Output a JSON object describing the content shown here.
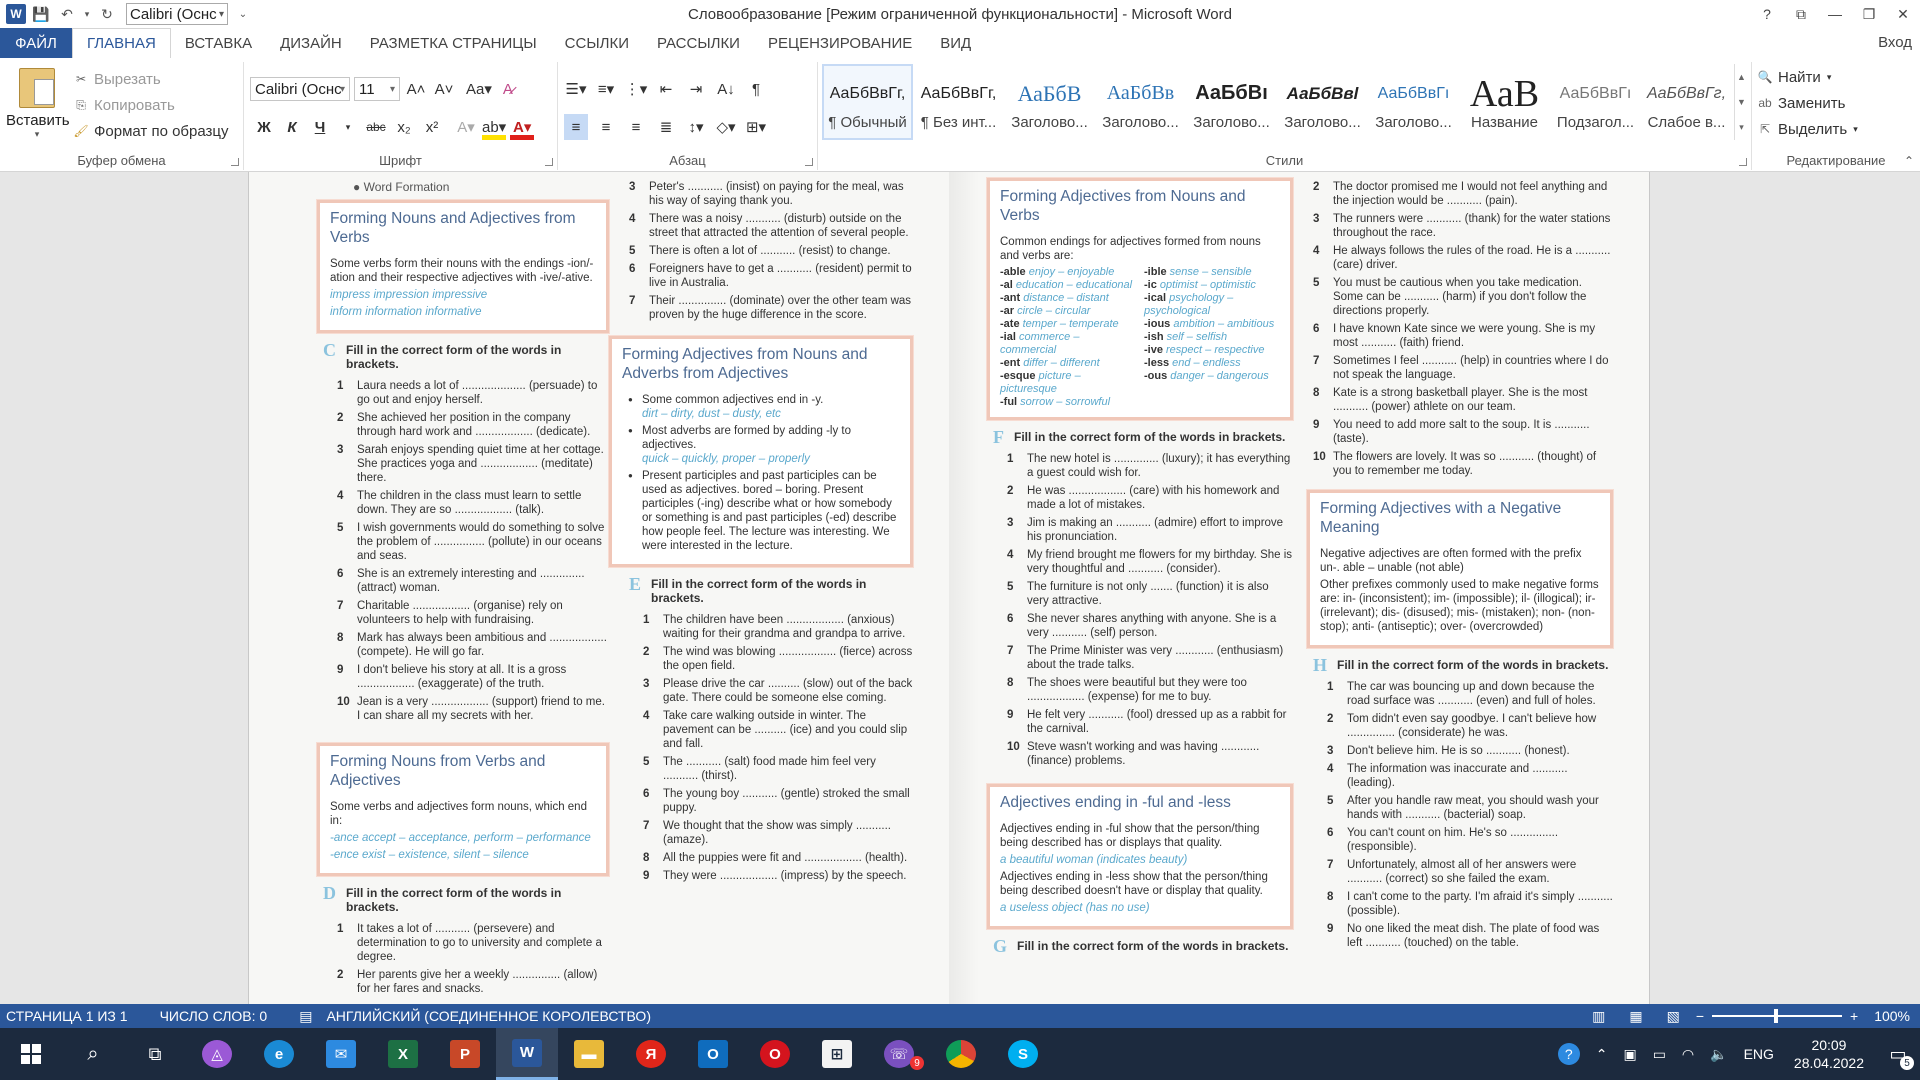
{
  "window": {
    "title": "Словообразование [Режим ограниченной функциональности] - Microsoft Word",
    "qat_font": "Calibri (Оснс",
    "help": "?",
    "sign_in": "Вход"
  },
  "tabs": [
    "ФАЙЛ",
    "ГЛАВНАЯ",
    "ВСТАВКА",
    "ДИЗАЙН",
    "РАЗМЕТКА СТРАНИЦЫ",
    "ССЫЛКИ",
    "РАССЫЛКИ",
    "РЕЦЕНЗИРОВАНИЕ",
    "ВИД"
  ],
  "ribbon": {
    "clipboard": {
      "paste": "Вставить",
      "cut": "Вырезать",
      "copy": "Копировать",
      "format_painter": "Формат по образцу",
      "label": "Буфер обмена"
    },
    "font": {
      "name": "Calibri (Оснс",
      "size": "11",
      "label": "Шрифт"
    },
    "paragraph": {
      "label": "Абзац"
    },
    "styles": {
      "label": "Стили",
      "items": [
        {
          "preview": "АаБбВвГг,",
          "name": "¶ Обычный"
        },
        {
          "preview": "АаБбВвГг,",
          "name": "¶ Без инт..."
        },
        {
          "preview": "АаБбВ",
          "name": "Заголово..."
        },
        {
          "preview": "АаБбВв",
          "name": "Заголово..."
        },
        {
          "preview": "АаБбВı",
          "name": "Заголово..."
        },
        {
          "preview": "АаБбВвl",
          "name": "Заголово..."
        },
        {
          "preview": "АаБбВвГı",
          "name": "Заголово..."
        },
        {
          "preview": "АаВ",
          "name": "Название"
        },
        {
          "preview": "АаБбВвГı",
          "name": "Подзагол..."
        },
        {
          "preview": "АаБбВвГг,",
          "name": "Слабое в..."
        }
      ]
    },
    "editing": {
      "find": "Найти",
      "replace": "Заменить",
      "select": "Выделить",
      "label": "Редактирование"
    }
  },
  "document": {
    "col1": {
      "bullet": "Word Formation",
      "box1_title": "Forming Nouns and Adjectives from Verbs",
      "box1_text": "Some verbs form their nouns with the endings -ion/-ation and their respective adjectives with -ive/-ative.",
      "box1_ex1": "impress   impression   impressive",
      "box1_ex2": "inform    information  informative",
      "sectionC_letter": "C",
      "sectionC_head": "Fill in the correct form of the words in brackets.",
      "sectionC_items": [
        "Laura needs a lot of .................... (persuade) to go out and enjoy herself.",
        "She achieved her position in the company through hard work and .................. (dedicate).",
        "Sarah enjoys spending quiet time at her cottage. She practices yoga and .................. (meditate) there.",
        "The children in the class must learn to settle down. They are so .................. (talk).",
        "I wish governments would do something to solve the problem of ................ (pollute) in our oceans and seas.",
        "She is an extremely interesting and .............. (attract) woman.",
        "Charitable .................. (organise) rely on volunteers to help with fundraising.",
        "Mark has always been ambitious and .................. (compete). He will go far.",
        "I don't believe his story at all. It is a gross .................. (exaggerate) of the truth.",
        "Jean is a very .................. (support) friend to me. I can share all my secrets with her."
      ],
      "box2_title": "Forming Nouns from Verbs and Adjectives",
      "box2_text": "Some verbs and adjectives form nouns, which end in:",
      "box2_ex1": "-ance accept – acceptance, perform – performance",
      "box2_ex2": "-ence exist – existence, silent – silence",
      "sectionD_letter": "D",
      "sectionD_head": "Fill in the correct form of the words in brackets.",
      "sectionD_items": [
        "It takes a lot of ........... (persevere) and determination to go to university and complete a degree.",
        "Her parents give her a weekly ............... (allow) for her fares and snacks."
      ]
    },
    "col2": {
      "items_top": [
        {
          "n": "3",
          "t": "Peter's ........... (insist) on paying for the meal, was his way of saying thank you."
        },
        {
          "n": "4",
          "t": "There was a noisy ........... (disturb) outside on the street that attracted the attention of several people."
        },
        {
          "n": "5",
          "t": "There is often a lot of ........... (resist) to change."
        },
        {
          "n": "6",
          "t": "Foreigners have to get a ........... (resident) permit to live in Australia."
        },
        {
          "n": "7",
          "t": "Their ............... (dominate) over the other team was proven by the huge difference in the score."
        }
      ],
      "box_title": "Forming Adjectives from Nouns and Adverbs from Adjectives",
      "box_b1": "Some common adjectives end in -y.",
      "box_b1_ex": "dirt – dirty, dust – dusty, etc",
      "box_b2": "Most adverbs are formed by adding -ly to adjectives.",
      "box_b2_ex": "quick – quickly, proper – properly",
      "box_b3": "Present participles and past participles can be used as adjectives. bored – boring. Present participles (-ing) describe what or how somebody or something is and past participles (-ed) describe how people feel. The lecture was interesting. We were interested in the lecture.",
      "sectionE_letter": "E",
      "sectionE_head": "Fill in the correct form of the words in brackets.",
      "sectionE_items": [
        "The children have been .................. (anxious) waiting for their grandma and grandpa to arrive.",
        "The wind was blowing .................. (fierce) across the open field.",
        "Please drive the car .......... (slow) out of the back gate. There could be someone else coming.",
        "Take care walking outside in winter. The pavement can be .......... (ice) and you could slip and fall.",
        "The ........... (salt) food made him feel very ........... (thirst).",
        "The young boy ........... (gentle) stroked the small puppy.",
        "We thought that the show was simply ........... (amaze).",
        "All the puppies were fit and .................. (health).",
        "They were .................. (impress) by the speech."
      ]
    },
    "col3": {
      "box_title": "Forming Adjectives from Nouns and Verbs",
      "box_text": "Common endings for adjectives formed from nouns and verbs are:",
      "endings_left": [
        "-able enjoy – enjoyable",
        "-al education – educational",
        "-ant distance – distant",
        "-ar circle – circular",
        "-ate temper – temperate",
        "-ial commerce – commercial",
        "-ent differ – different",
        "-esque picture – picturesque",
        "-ful sorrow – sorrowful"
      ],
      "endings_right": [
        "-ible sense – sensible",
        "-ic optimist – optimistic",
        "-ical psychology – psychological",
        "-ious ambition – ambitious",
        "-ish self – selfish",
        "-ive respect – respective",
        "-less end – endless",
        "-ous danger – dangerous"
      ],
      "sectionF_letter": "F",
      "sectionF_head": "Fill in the correct form of the words in brackets.",
      "sectionF_items": [
        "The new hotel is .............. (luxury); it has everything a guest could wish for.",
        "He was .................. (care) with his homework and made a lot of mistakes.",
        "Jim is making an ........... (admire) effort to improve his pronunciation.",
        "My friend brought me flowers for my birthday. She is very thoughtful and ........... (consider).",
        "The furniture is not only ....... (function) it is also very attractive.",
        "She never shares anything with anyone. She is a very ........... (self) person.",
        "The Prime Minister was very ............ (enthusiasm) about the trade talks.",
        "The shoes were beautiful but they were too .................. (expense) for me to buy.",
        "He felt very ........... (fool) dressed up as a rabbit for the carnival.",
        "Steve wasn't working and was having ............ (finance) problems."
      ],
      "box2_title": "Adjectives ending in -ful and -less",
      "box2_p1": "Adjectives ending in -ful show that the person/thing being described has or displays that quality.",
      "box2_ex1": "a beautiful woman (indicates beauty)",
      "box2_p2": "Adjectives ending in -less show that the person/thing being described doesn't have or display that quality.",
      "box2_ex2": "a useless object (has no use)",
      "sectionG_letter": "G",
      "sectionG_head": "Fill in the correct form of the words in brackets."
    },
    "col4": {
      "items_top": [
        {
          "n": "2",
          "t": "The doctor promised me I would not feel anything and the injection would be ........... (pain)."
        },
        {
          "n": "3",
          "t": "The runners were ........... (thank) for the water stations throughout the race."
        },
        {
          "n": "4",
          "t": "He always follows the rules of the road. He is a ........... (care) driver."
        },
        {
          "n": "5",
          "t": "You must be cautious when you take medication. Some can be ........... (harm) if you don't follow the directions properly."
        },
        {
          "n": "6",
          "t": "I have known Kate since we were young. She is my most ........... (faith) friend."
        },
        {
          "n": "7",
          "t": "Sometimes I feel ........... (help) in countries where I do not speak the language."
        },
        {
          "n": "8",
          "t": "Kate is a strong basketball player. She is the most ........... (power) athlete on our team."
        },
        {
          "n": "9",
          "t": "You need to add more salt to the soup. It is ........... (taste)."
        },
        {
          "n": "10",
          "t": "The flowers are lovely. It was so ........... (thought) of you to remember me today."
        }
      ],
      "box_title": "Forming Adjectives with a Negative Meaning",
      "box_p1": "Negative adjectives are often formed with the prefix un-. able – unable (not able)",
      "box_p2": "Other prefixes commonly used to make negative forms are: in- (inconsistent); im- (impossible); il- (illogical); ir- (irrelevant); dis- (disused); mis- (mistaken); non- (non-stop); anti- (antiseptic); over- (overcrowded)",
      "sectionH_letter": "H",
      "sectionH_head": "Fill in the correct form of the words in brackets.",
      "sectionH_items": [
        "The car was bouncing up and down because the road surface was ........... (even) and full of holes.",
        "Tom didn't even say goodbye. I can't believe how ............... (considerate) he was.",
        "Don't believe him. He is so ........... (honest).",
        "The information was inaccurate and ........... (leading).",
        "After you handle raw meat, you should wash your hands with ........... (bacterial) soap.",
        "You can't count on him. He's so ............... (responsible).",
        "Unfortunately, almost all of her answers were ........... (correct) so she failed the exam.",
        "I can't come to the party. I'm afraid it's simply ........... (possible).",
        "No one liked the meat dish. The plate of food was left ........... (touched) on the table."
      ]
    }
  },
  "status": {
    "page": "СТРАНИЦА 1 ИЗ 1",
    "words": "ЧИСЛО СЛОВ: 0",
    "lang": "АНГЛИЙСКИЙ (СОЕДИНЕННОЕ КОРОЛЕВСТВО)",
    "zoom": "100%"
  },
  "taskbar": {
    "lang": "ENG",
    "time": "20:09",
    "date": "28.04.2022",
    "viber_badge": "9",
    "notif_badge": "5"
  }
}
